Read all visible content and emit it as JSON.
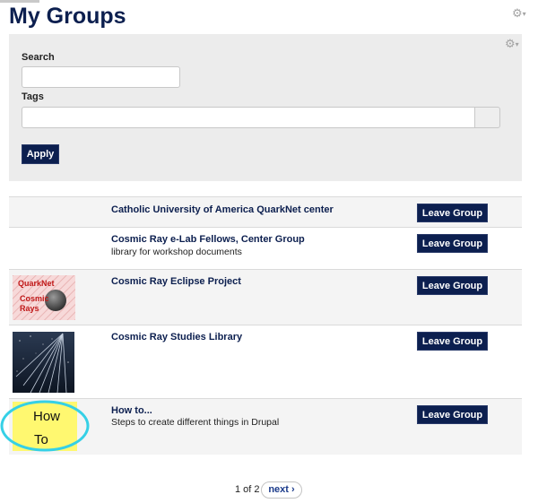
{
  "page": {
    "title": "My Groups"
  },
  "filters": {
    "search_label": "Search",
    "search_value": "",
    "tags_label": "Tags",
    "tags_value": "",
    "apply_label": "Apply"
  },
  "groups": [
    {
      "title": "Catholic University of America QuarkNet center",
      "description": "",
      "button": "Leave Group"
    },
    {
      "title": "Cosmic Ray e-Lab Fellows, Center Group",
      "description": "library for workshop documents",
      "button": "Leave Group"
    },
    {
      "title": "Cosmic Ray Eclipse Project",
      "description": "",
      "button": "Leave Group",
      "thumbnail_text": [
        "QuarkNet",
        "Cosmic",
        "Rays"
      ]
    },
    {
      "title": "Cosmic Ray Studies Library",
      "description": "",
      "button": "Leave Group"
    },
    {
      "title": "How to...",
      "description": "Steps to create different things in Drupal",
      "button": "Leave Group",
      "thumbnail_text": [
        "How",
        "To"
      ]
    }
  ],
  "pager": {
    "count": "1 of 2",
    "next": "next ›"
  },
  "colors": {
    "brand": "#0c1f4f",
    "panel": "#ececec",
    "row_alt": "#f4f4f4"
  }
}
